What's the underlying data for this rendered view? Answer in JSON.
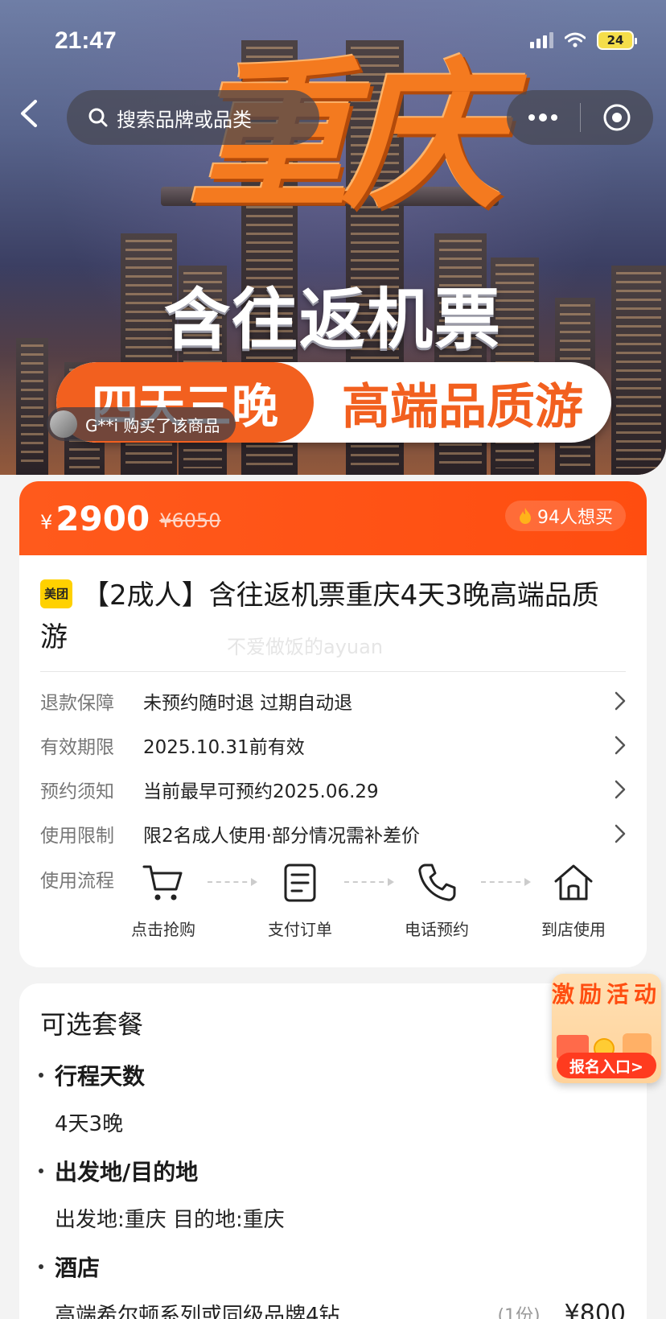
{
  "status_bar": {
    "time": "21:47",
    "battery": "24"
  },
  "nav": {
    "search_placeholder": "搜索品牌或品类"
  },
  "hero": {
    "title_big": "重庆",
    "title_sub": "含往返机票",
    "banner_left": "四天三晚",
    "banner_right": "高端品质游",
    "buyer_notice": "G**i 购买了该商品"
  },
  "price": {
    "currency": "¥",
    "current": "2900",
    "original": "¥6050",
    "want_count": "94人想买"
  },
  "product": {
    "brand_logo": "美团",
    "title": "【2成人】含往返机票重庆4天3晚高端品质游",
    "watermark": "不爱做饭的ayuan"
  },
  "info_rows": [
    {
      "key": "退款保障",
      "value": "未预约随时退 过期自动退"
    },
    {
      "key": "有效期限",
      "value": "2025.10.31前有效"
    },
    {
      "key": "预约须知",
      "value": "当前最早可预约2025.06.29"
    },
    {
      "key": "使用限制",
      "value": "限2名成人使用·部分情况需补差价"
    }
  ],
  "flow": {
    "key": "使用流程",
    "steps": [
      {
        "label": "点击抢购",
        "icon": "cart-icon"
      },
      {
        "label": "支付订单",
        "icon": "document-icon"
      },
      {
        "label": "电话预约",
        "icon": "phone-icon"
      },
      {
        "label": "到店使用",
        "icon": "home-icon"
      }
    ]
  },
  "packages": {
    "title": "可选套餐",
    "sections": [
      {
        "head": "行程天数",
        "value": "4天3晚"
      },
      {
        "head": "出发地/目的地",
        "value": "出发地:重庆 目的地:重庆"
      },
      {
        "head": "酒店",
        "value": "高端希尔顿系列或同级品牌4钻",
        "qty": "(1份)",
        "price": "¥800"
      }
    ]
  },
  "promo": {
    "title": "激励活动",
    "button": "报名入口>"
  },
  "colors": {
    "accent": "#ff4d10",
    "brand_yellow": "#ffd100"
  }
}
